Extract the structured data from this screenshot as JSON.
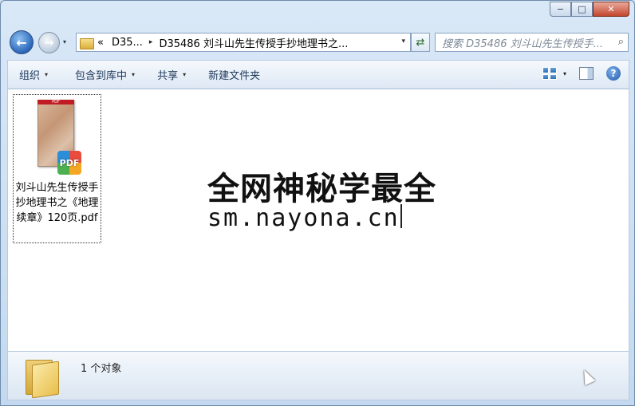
{
  "window": {
    "caption": {
      "minimize": "−",
      "maximize": "□",
      "close": "✕"
    }
  },
  "nav": {
    "back_glyph": "←",
    "forward_glyph": "→",
    "history_glyph": "▾"
  },
  "address": {
    "overflow": "«",
    "crumbs": [
      "D35...",
      "D35486 刘斗山先生传授手抄地理书之..."
    ],
    "separator": "▸",
    "dropdown": "▾"
  },
  "refresh_glyph": "⇄",
  "search": {
    "placeholder": "搜索 D35486 刘斗山先生传授手...",
    "icon_glyph": "⌕"
  },
  "toolbar": {
    "organize": "组织",
    "include_in_library": "包含到库中",
    "share": "共享",
    "new_folder": "新建文件夹",
    "dropdown": "▾",
    "help": "?"
  },
  "files": [
    {
      "name": "刘斗山先生传授手抄地理书之《地理续章》120页.pdf",
      "badge": "PDF",
      "thumb_label": "PDF"
    }
  ],
  "watermark": {
    "line1": "全网神秘学最全",
    "line2": "sm.nayona.cn"
  },
  "details": {
    "count": "1 个对象"
  },
  "colors": {
    "accent": "#1e395b",
    "pdf_red": "#c01c24",
    "folder": "#e8bf4b"
  }
}
